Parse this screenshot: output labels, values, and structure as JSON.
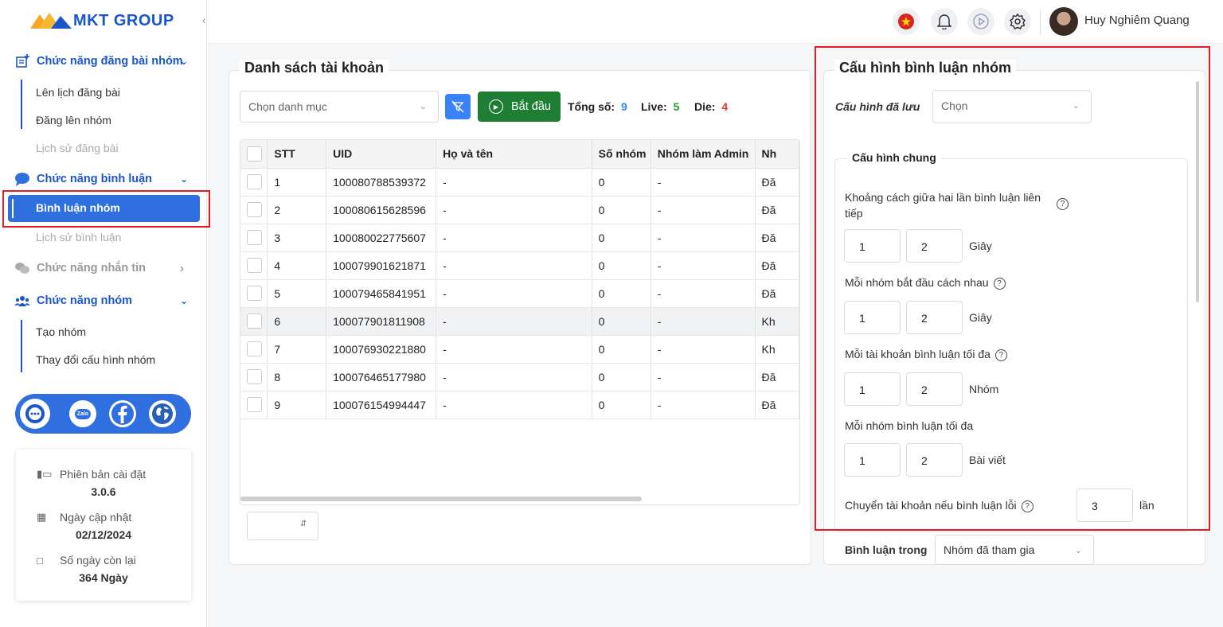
{
  "brand": {
    "name": "MKT GROUP"
  },
  "sidebar": {
    "sections": [
      {
        "label": "Chức năng đăng bài nhóm",
        "items": [
          "Lên lịch đăng bài",
          "Đăng lên nhóm",
          "Lịch sử đăng bài"
        ]
      },
      {
        "label": "Chức năng bình luận",
        "items": [
          "Bình luận nhóm",
          "Lịch sử bình luận"
        ]
      },
      {
        "label": "Chức năng nhắn tin",
        "items": []
      },
      {
        "label": "Chức năng nhóm",
        "items": [
          "Tạo nhóm",
          "Thay đổi cấu hình nhóm"
        ]
      }
    ],
    "social": {
      "zalo": "Zalo"
    },
    "info": {
      "version_label": "Phiên bản cài đặt",
      "version_value": "3.0.6",
      "updated_label": "Ngày cập nhật",
      "updated_value": "02/12/2024",
      "days_label": "Số ngày còn lại",
      "days_value": "364 Ngày"
    }
  },
  "topbar": {
    "user_name": "Huy Nghiêm Quang"
  },
  "accounts": {
    "title": "Danh sách tài khoản",
    "category_placeholder": "Chọn danh mục",
    "start_label": "Bắt đầu",
    "total_label": "Tổng số:",
    "total_value": "9",
    "live_label": "Live:",
    "live_value": "5",
    "die_label": "Die:",
    "die_value": "4",
    "columns": [
      "STT",
      "UID",
      "Họ và tên",
      "Số nhóm",
      "Nhóm làm Admin",
      "Nh"
    ],
    "rows": [
      [
        "1",
        "100080788539372",
        "-",
        "0",
        "-",
        "Đă"
      ],
      [
        "2",
        "100080615628596",
        "-",
        "0",
        "-",
        "Đă"
      ],
      [
        "3",
        "100080022775607",
        "-",
        "0",
        "-",
        "Đă"
      ],
      [
        "4",
        "100079901621871",
        "-",
        "0",
        "-",
        "Đă"
      ],
      [
        "5",
        "100079465841951",
        "-",
        "0",
        "-",
        "Đă"
      ],
      [
        "6",
        "100077901811908",
        "-",
        "0",
        "-",
        "Kh"
      ],
      [
        "7",
        "100076930221880",
        "-",
        "0",
        "-",
        "Kh"
      ],
      [
        "8",
        "100076465177980",
        "-",
        "0",
        "-",
        "Đă"
      ],
      [
        "9",
        "100076154994447",
        "-",
        "0",
        "-",
        "Đă"
      ]
    ]
  },
  "config": {
    "title": "Cấu hình bình luận nhóm",
    "saved_label": "Cấu hình đã lưu",
    "saved_value": "Chọn",
    "general_title": "Cấu hình chung",
    "interval_label": "Khoảng cách giữa hai lần bình luận liên tiếp",
    "interval_min": "1",
    "interval_max": "2",
    "interval_unit": "Giây",
    "group_delay_label": "Mỗi nhóm bắt đầu cách nhau",
    "group_delay_min": "1",
    "group_delay_max": "2",
    "group_delay_unit": "Giây",
    "max_per_account_label": "Mỗi tài khoản bình luận tối đa",
    "max_per_account_min": "1",
    "max_per_account_max": "2",
    "max_per_account_unit": "Nhóm",
    "max_per_group_label": "Mỗi nhóm bình luận tối đa",
    "max_per_group_min": "1",
    "max_per_group_max": "2",
    "max_per_group_unit": "Bài viết",
    "switch_label": "Chuyển tài khoản nếu bình luận lỗi",
    "switch_value": "3",
    "switch_unit": "lần",
    "comment_in_label": "Bình luận trong",
    "comment_in_value": "Nhóm đã tham gia"
  }
}
